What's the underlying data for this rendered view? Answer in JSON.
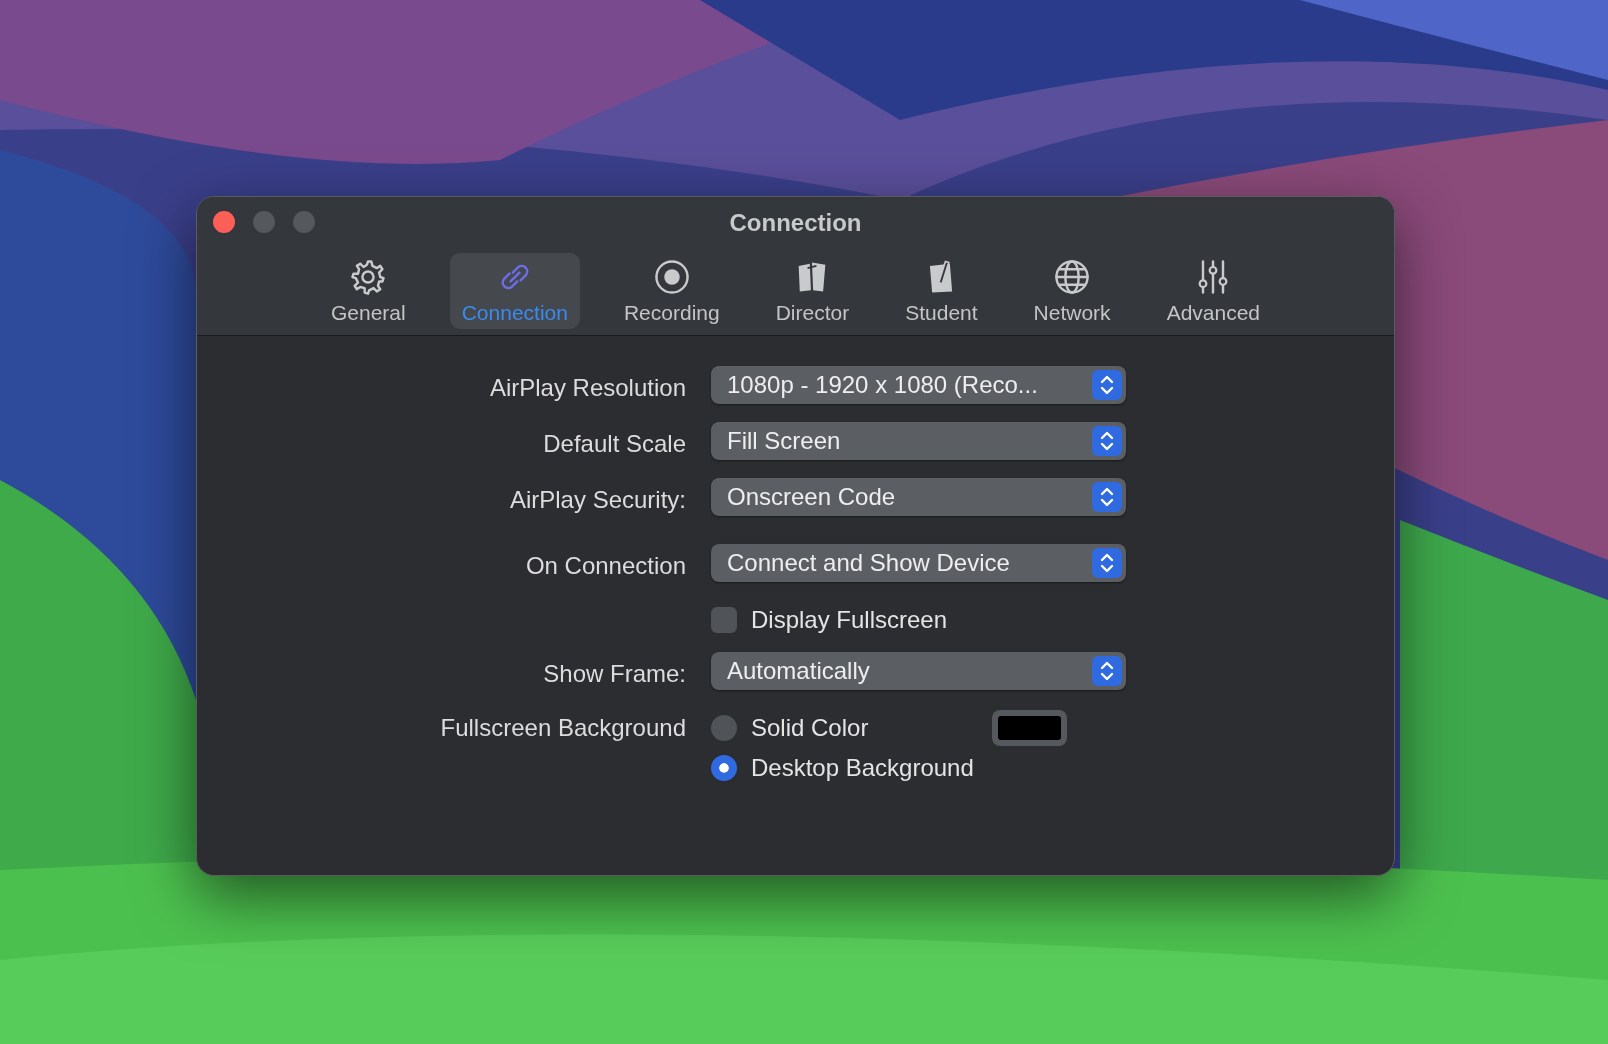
{
  "window": {
    "title": "Connection"
  },
  "tabs": [
    {
      "label": "General",
      "selected": false
    },
    {
      "label": "Connection",
      "selected": true
    },
    {
      "label": "Recording",
      "selected": false
    },
    {
      "label": "Director",
      "selected": false
    },
    {
      "label": "Student",
      "selected": false
    },
    {
      "label": "Network",
      "selected": false
    },
    {
      "label": "Advanced",
      "selected": false
    }
  ],
  "form": [
    {
      "kind": "popup",
      "label": "AirPlay Resolution",
      "value": "1080p - 1920 x 1080 (Reco..."
    },
    {
      "kind": "popup",
      "label": "Default Scale",
      "value": "Fill Screen"
    },
    {
      "kind": "popup",
      "label": "AirPlay Security:",
      "value": "Onscreen Code"
    },
    {
      "kind": "popup",
      "label": "On Connection",
      "value": "Connect and Show Device"
    },
    {
      "kind": "checkbox",
      "label": "Display Fullscreen",
      "checked": false
    },
    {
      "kind": "popup",
      "label": "Show Frame:",
      "value": "Automatically"
    },
    {
      "kind": "radios",
      "label": "Fullscreen Background",
      "options": [
        {
          "label": "Solid Color",
          "selected": false,
          "color": "#000000"
        },
        {
          "label": "Desktop Background",
          "selected": true
        }
      ]
    }
  ]
}
